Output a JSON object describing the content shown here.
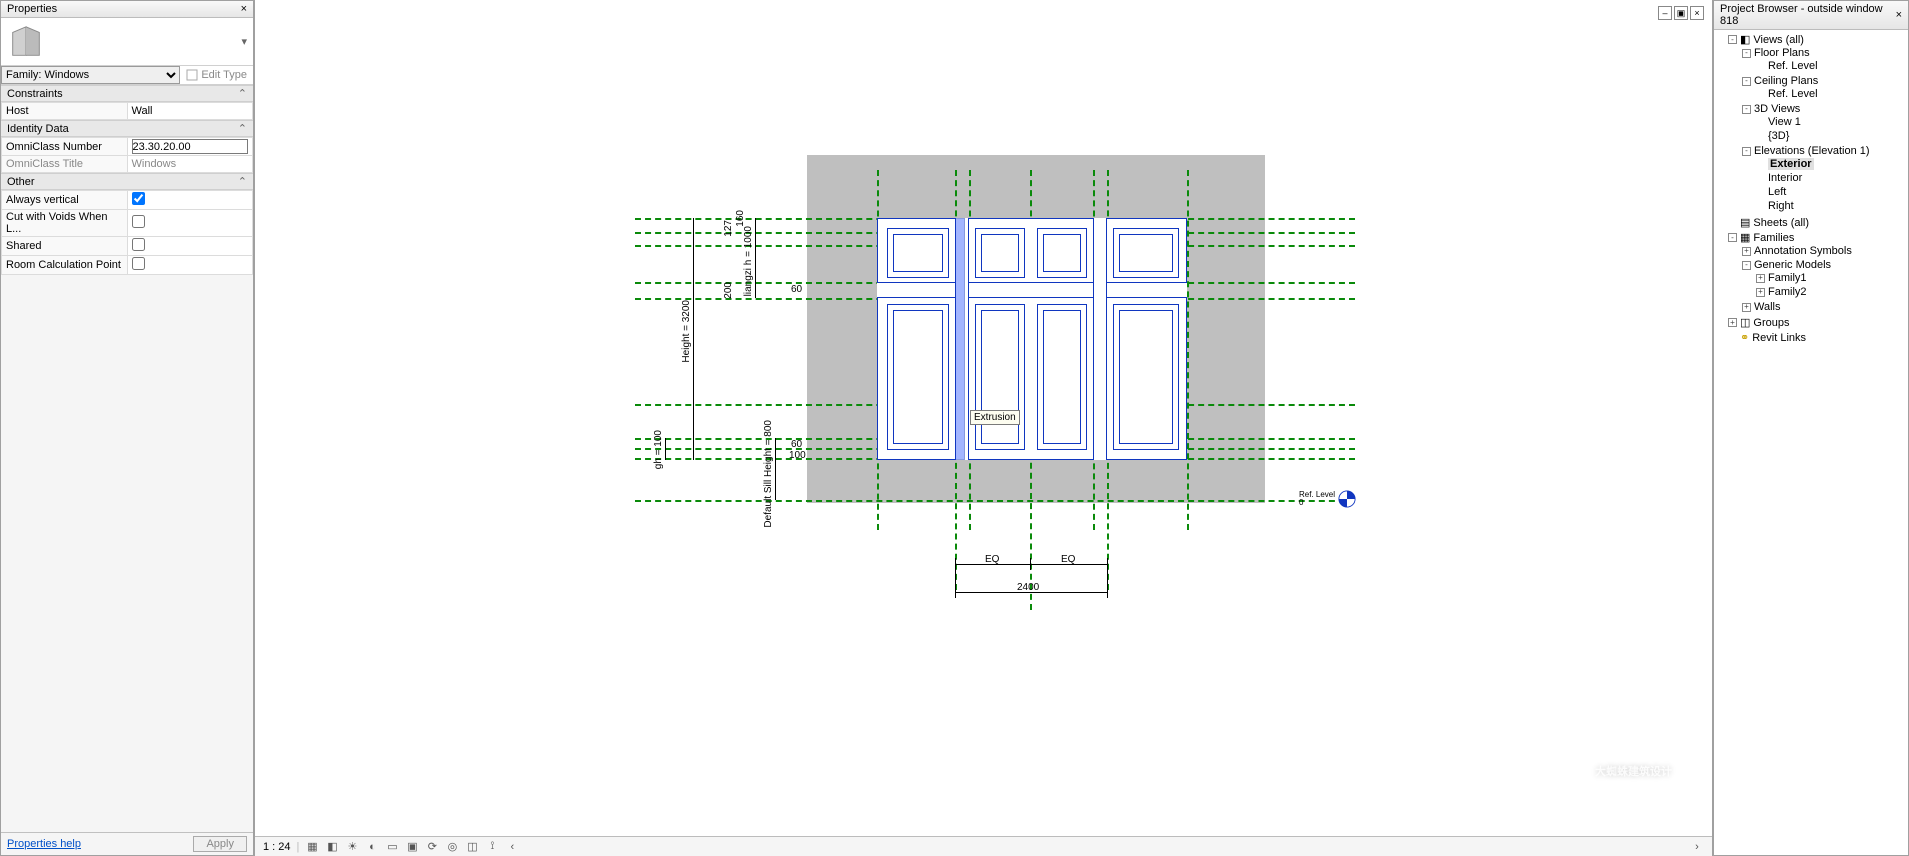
{
  "properties": {
    "title": "Properties",
    "family_selector": "Family: Windows",
    "edit_type": "Edit Type",
    "sections": {
      "constraints": "Constraints",
      "identity": "Identity Data",
      "other": "Other"
    },
    "rows": {
      "host_label": "Host",
      "host_value": "Wall",
      "omni_num_label": "OmniClass Number",
      "omni_num_value": "23.30.20.00",
      "omni_title_label": "OmniClass Title",
      "omni_title_value": "Windows",
      "always_vertical": "Always vertical",
      "cut_voids": "Cut with Voids When L...",
      "shared": "Shared",
      "room_calc": "Room Calculation Point"
    },
    "help": "Properties help",
    "apply": "Apply"
  },
  "canvas": {
    "extrusion_label": "Extrusion",
    "dims": {
      "height": "Height = 3200",
      "gh": "gh = 100",
      "sill": "Default Sill Height = 800",
      "liangzi": "liangzi h = 1000",
      "d127": "127",
      "d160": "160",
      "d200": "200",
      "d60a": "60",
      "d60b": "60",
      "d100": "100",
      "eq1": "EQ",
      "eq2": "EQ",
      "width": "2400"
    },
    "level": "Ref. Level",
    "level_sub": "0"
  },
  "statusbar": {
    "scale": "1 : 24"
  },
  "browser": {
    "title": "Project Browser - outside window 818",
    "views_all": "Views (all)",
    "floor_plans": "Floor Plans",
    "ref_level1": "Ref. Level",
    "ceiling_plans": "Ceiling Plans",
    "ref_level2": "Ref. Level",
    "views3d": "3D Views",
    "view1": "View 1",
    "view3d": "{3D}",
    "elevations": "Elevations (Elevation 1)",
    "exterior": "Exterior",
    "interior": "Interior",
    "left": "Left",
    "right": "Right",
    "sheets": "Sheets (all)",
    "families": "Families",
    "annotation": "Annotation Symbols",
    "generic": "Generic Models",
    "family1": "Family1",
    "family2": "Family2",
    "walls": "Walls",
    "groups": "Groups",
    "revit_links": "Revit Links"
  },
  "watermark": "大蜘蛛建筑设计"
}
